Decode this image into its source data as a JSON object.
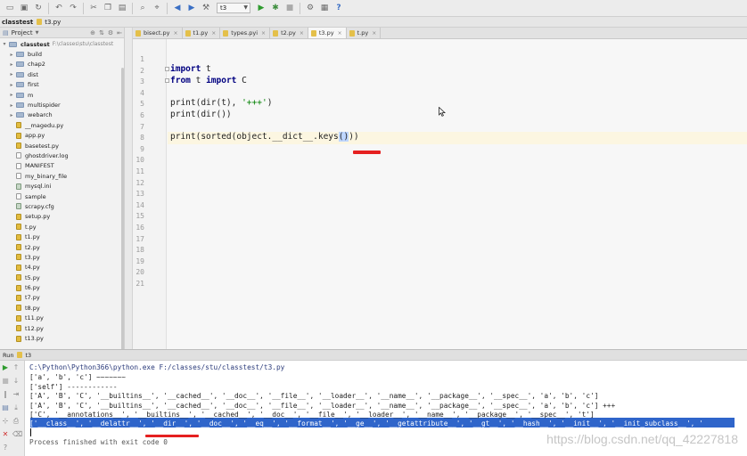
{
  "toolbar": {
    "run_config": "t3",
    "help_icon_glyph": "?"
  },
  "navbar": {
    "project": "classtest",
    "file": "t3.py"
  },
  "project_panel": {
    "title": "Project",
    "root": {
      "name": "classtest",
      "path": "F:\\classes\\stu\\classtest"
    },
    "items": [
      {
        "label": "build",
        "kind": "folder"
      },
      {
        "label": "chap2",
        "kind": "folder"
      },
      {
        "label": "dist",
        "kind": "folder"
      },
      {
        "label": "first",
        "kind": "folder"
      },
      {
        "label": "m",
        "kind": "folder"
      },
      {
        "label": "multispider",
        "kind": "folder"
      },
      {
        "label": "webarch",
        "kind": "folder"
      },
      {
        "label": "__magedu.py",
        "kind": "py"
      },
      {
        "label": "app.py",
        "kind": "py"
      },
      {
        "label": "basetest.py",
        "kind": "py"
      },
      {
        "label": "ghostdriver.log",
        "kind": "txt"
      },
      {
        "label": "MANIFEST",
        "kind": "txt"
      },
      {
        "label": "my_binary_file",
        "kind": "txt"
      },
      {
        "label": "mysql.ini",
        "kind": "cfg"
      },
      {
        "label": "sample",
        "kind": "txt"
      },
      {
        "label": "scrapy.cfg",
        "kind": "cfg"
      },
      {
        "label": "setup.py",
        "kind": "py"
      },
      {
        "label": "t.py",
        "kind": "py"
      },
      {
        "label": "t1.py",
        "kind": "py"
      },
      {
        "label": "t2.py",
        "kind": "py"
      },
      {
        "label": "t3.py",
        "kind": "py"
      },
      {
        "label": "t4.py",
        "kind": "py"
      },
      {
        "label": "t5.py",
        "kind": "py"
      },
      {
        "label": "t6.py",
        "kind": "py"
      },
      {
        "label": "t7.py",
        "kind": "py"
      },
      {
        "label": "t8.py",
        "kind": "py"
      },
      {
        "label": "t11.py",
        "kind": "py"
      },
      {
        "label": "t12.py",
        "kind": "py"
      },
      {
        "label": "t13.py",
        "kind": "py"
      }
    ]
  },
  "tabs": [
    {
      "label": "bisect.py",
      "active": false
    },
    {
      "label": "t1.py",
      "active": false
    },
    {
      "label": "types.pyi",
      "active": false
    },
    {
      "label": "t2.py",
      "active": false
    },
    {
      "label": "t3.py",
      "active": true
    },
    {
      "label": "t.py",
      "active": false
    }
  ],
  "editor": {
    "line_numbers": [
      "1",
      "2",
      "3",
      "4",
      "5",
      "6",
      "7",
      "8",
      "9",
      "10",
      "11",
      "12",
      "13",
      "14",
      "15",
      "16",
      "17",
      "18",
      "19",
      "20",
      "21"
    ],
    "current_line": 8,
    "code": {
      "l2_kw": "import",
      "l2_rest": " t",
      "l3_kw": "from",
      "l3_mid": " t ",
      "l3_kw2": "import",
      "l3_rest": " C",
      "l5_pre": "print(dir(t), ",
      "l5_str": "'+++'",
      "l5_post": ")",
      "l6": "print(dir())",
      "l8_pre": "print(sorted(object.__dict__.keys",
      "l8_hl": "()",
      "l8_post": "))"
    }
  },
  "run_panel": {
    "label": "Run",
    "config": "t3",
    "output": [
      "C:\\Python\\Python366\\python.exe F:/classes/stu/classtest/t3.py",
      "['a', 'b', 'c'] ~~~~~~~",
      "['self'] ------------",
      "['A', 'B', 'C', '__builtins__', '__cached__', '__doc__', '__file__', '__loader__', '__name__', '__package__', '__spec__', 'a', 'b', 'c']",
      "['A', 'B', 'C', '__builtins__', '__cached__', '__doc__', '__file__', '__loader__', '__name__', '__package__', '__spec__', 'a', 'b', 'c'] +++",
      "['C', '__annotations__', '__builtins__', '__cached__', '__doc__', '__file__', '__loader__', '__name__', '__package__', '__spec__', 't']",
      "['__class__', '__delattr__', '__dir__', '__doc__', '__eq__', '__format__', '__ge__', '__getattribute__', '__gt__', '__hash__', '__init__', '__init_subclass__', '",
      "Process finished with exit code 0"
    ]
  },
  "watermark": "https://blog.csdn.net/qq_42227818",
  "colors": {
    "selection": "#2f65ca",
    "annotation": "#e52020",
    "current_line": "#fcf6e1",
    "keyword": "#000080",
    "string": "#008000"
  }
}
